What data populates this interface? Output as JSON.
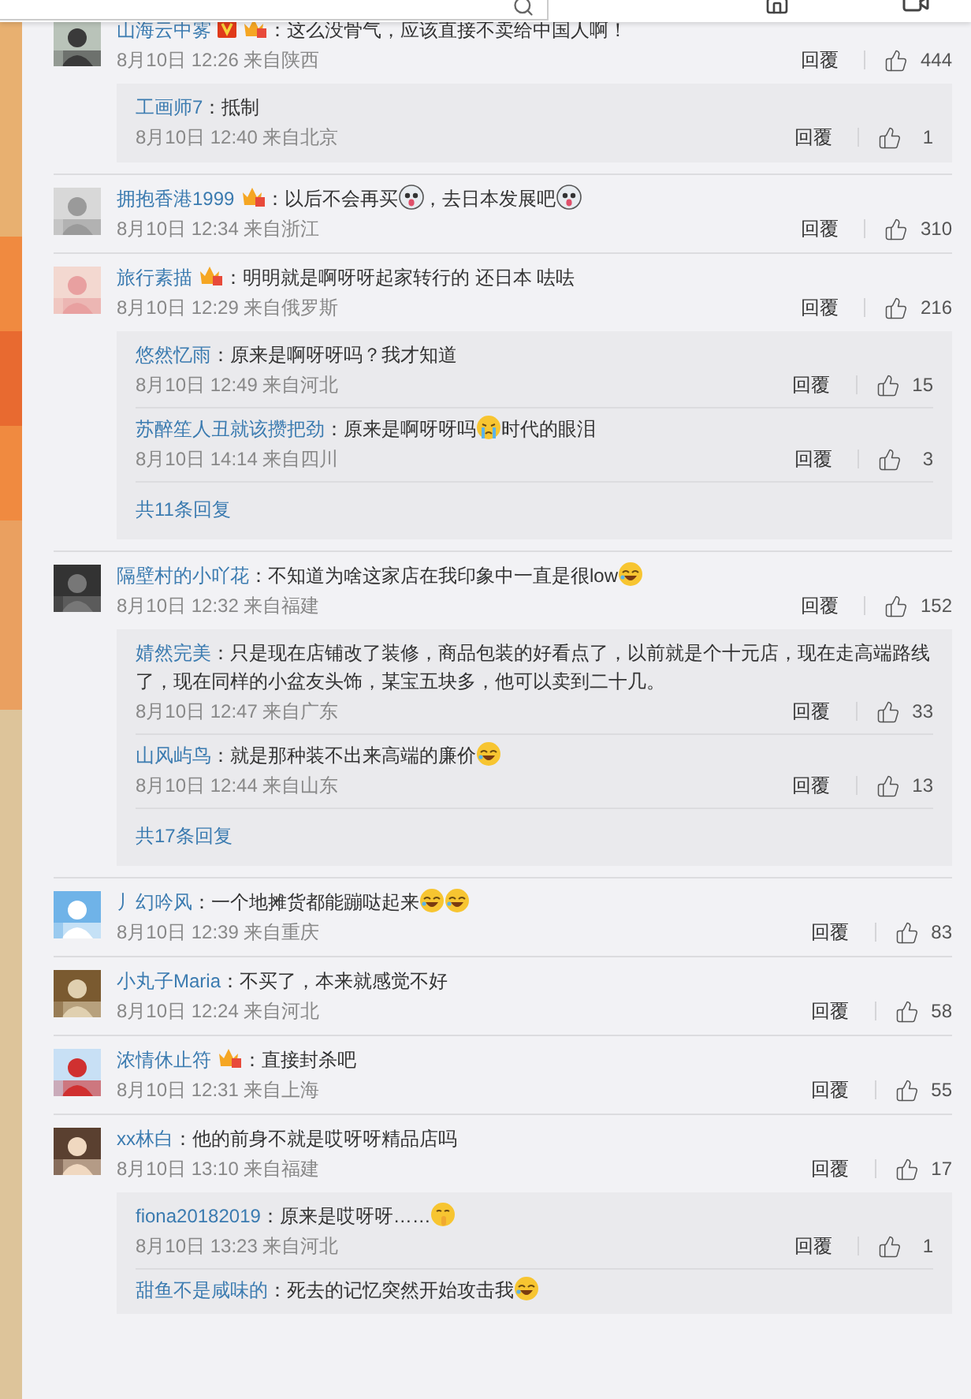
{
  "comments": [
    {
      "user": "山海云中雾",
      "badges": [
        {
          "kind": "v"
        },
        {
          "kind": "crown"
        }
      ],
      "content": [
        {
          "kind": "text",
          "text": "：这么没骨气，应该直接不卖给中国人啊！"
        }
      ],
      "meta": "8月10日 12:26 来自陕西",
      "reply_label": "回覆",
      "likes": "444",
      "replies": [
        {
          "user": "工画师7",
          "content": [
            {
              "kind": "text",
              "text": "：抵制"
            }
          ],
          "meta": "8月10日 12:40 来自北京",
          "reply_label": "回覆",
          "likes": "1"
        }
      ]
    },
    {
      "user": "拥抱香港1999",
      "badges": [
        {
          "kind": "crown"
        }
      ],
      "content": [
        {
          "kind": "text",
          "text": "：以后不会再买"
        },
        {
          "kind": "doge"
        },
        {
          "kind": "text",
          "text": "，去日本发展吧"
        },
        {
          "kind": "doge"
        }
      ],
      "meta": "8月10日 12:34 来自浙江",
      "reply_label": "回覆",
      "likes": "310"
    },
    {
      "user": "旅行素描",
      "badges": [
        {
          "kind": "crown"
        }
      ],
      "content": [
        {
          "kind": "text",
          "text": "：明明就是啊呀呀起家转行的 还日本 呿呿"
        }
      ],
      "meta": "8月10日 12:29 来自俄罗斯",
      "reply_label": "回覆",
      "likes": "216",
      "replies": [
        {
          "user": "悠然忆雨",
          "content": [
            {
              "kind": "text",
              "text": "：原来是啊呀呀吗？我才知道"
            }
          ],
          "meta": "8月10日 12:49 来自河北",
          "reply_label": "回覆",
          "likes": "15"
        },
        {
          "user": "苏醉笙人丑就该攒把劲",
          "content": [
            {
              "kind": "text",
              "text": "：原来是啊呀呀吗"
            },
            {
              "kind": "cry"
            },
            {
              "kind": "text",
              "text": "时代的眼泪"
            }
          ],
          "meta": "8月10日 14:14 来自四川",
          "reply_label": "回覆",
          "likes": "3"
        }
      ],
      "more": "共11条回复"
    },
    {
      "user": "隔壁村的小吖花",
      "content": [
        {
          "kind": "text",
          "text": "：不知道为啥这家店在我印象中一直是很low"
        },
        {
          "kind": "laugh"
        }
      ],
      "meta": "8月10日 12:32 来自福建",
      "reply_label": "回覆",
      "likes": "152",
      "replies": [
        {
          "user": "婧然完美",
          "content": [
            {
              "kind": "text",
              "text": "：只是现在店铺改了装修，商品包装的好看点了，以前就是个十元店，现在走高端路线了，现在同样的小盆友头饰，某宝五块多，他可以卖到二十几。"
            }
          ],
          "meta": "8月10日 12:47 来自广东",
          "reply_label": "回覆",
          "likes": "33"
        },
        {
          "user": "山风屿鸟",
          "content": [
            {
              "kind": "text",
              "text": "：就是那种装不出来高端的廉价"
            },
            {
              "kind": "laugh"
            }
          ],
          "meta": "8月10日 12:44 来自山东",
          "reply_label": "回覆",
          "likes": "13"
        }
      ],
      "more": "共17条回复"
    },
    {
      "user": "丿幻吟风",
      "content": [
        {
          "kind": "text",
          "text": "：一个地摊货都能蹦哒起来"
        },
        {
          "kind": "laugh"
        },
        {
          "kind": "laugh"
        }
      ],
      "meta": "8月10日 12:39 来自重庆",
      "reply_label": "回覆",
      "likes": "83"
    },
    {
      "user": "小丸子Maria",
      "content": [
        {
          "kind": "text",
          "text": "：不买了，本来就感觉不好"
        }
      ],
      "meta": "8月10日 12:24 来自河北",
      "reply_label": "回覆",
      "likes": "58"
    },
    {
      "user": "浓情休止符",
      "badges": [
        {
          "kind": "crown"
        }
      ],
      "content": [
        {
          "kind": "text",
          "text": "：直接封杀吧"
        }
      ],
      "meta": "8月10日 12:31 来自上海",
      "reply_label": "回覆",
      "likes": "55"
    },
    {
      "user": "xx林白",
      "content": [
        {
          "kind": "text",
          "text": "：他的前身不就是哎呀呀精品店吗"
        }
      ],
      "meta": "8月10日 13:10 来自福建",
      "reply_label": "回覆",
      "likes": "17",
      "replies": [
        {
          "user": "fiona20182019",
          "content": [
            {
              "kind": "text",
              "text": "：原来是哎呀呀……"
            },
            {
              "kind": "shush"
            }
          ],
          "meta": "8月10日 13:23 来自河北",
          "reply_label": "回覆",
          "likes": "1"
        },
        {
          "user": "甜鱼不是咸味的",
          "content": [
            {
              "kind": "text",
              "text": "：死去的记忆突然开始攻击我"
            },
            {
              "kind": "laugh"
            }
          ]
        }
      ]
    }
  ]
}
